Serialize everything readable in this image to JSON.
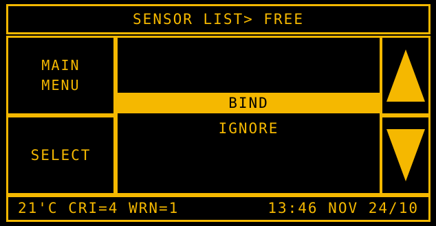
{
  "header": {
    "title": "SENSOR LIST> FREE"
  },
  "left_menu": {
    "main_menu_label": "MAIN\nMENU",
    "select_label": "SELECT"
  },
  "list": {
    "items": [
      {
        "label": "BIND",
        "selected": true
      },
      {
        "label": "IGNORE",
        "selected": false
      }
    ]
  },
  "status_bar": {
    "readings": "21'C CRI=4 WRN=1",
    "datetime": "13:46 NOV 24/10"
  },
  "icons": {
    "scroll_up": "triangle-up-icon",
    "scroll_down": "triangle-down-icon"
  },
  "colors": {
    "accent": "#f5b800",
    "background": "#000000"
  }
}
